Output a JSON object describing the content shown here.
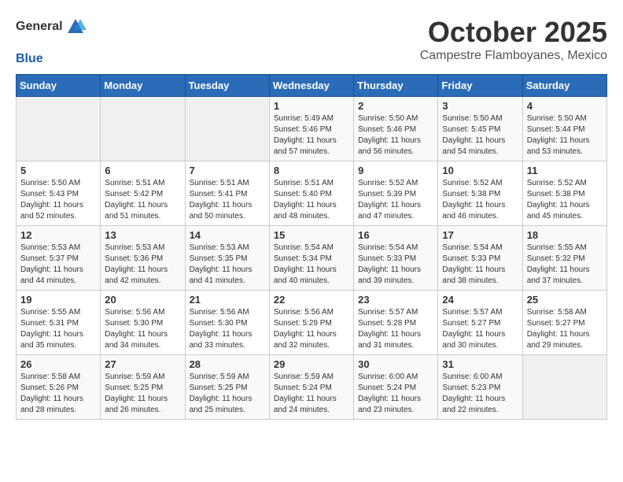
{
  "header": {
    "logo_general": "General",
    "logo_blue": "Blue",
    "month_title": "October 2025",
    "location": "Campestre Flamboyanes, Mexico"
  },
  "weekdays": [
    "Sunday",
    "Monday",
    "Tuesday",
    "Wednesday",
    "Thursday",
    "Friday",
    "Saturday"
  ],
  "weeks": [
    [
      {
        "day": "",
        "info": ""
      },
      {
        "day": "",
        "info": ""
      },
      {
        "day": "",
        "info": ""
      },
      {
        "day": "1",
        "info": "Sunrise: 5:49 AM\nSunset: 5:46 PM\nDaylight: 11 hours and 57 minutes."
      },
      {
        "day": "2",
        "info": "Sunrise: 5:50 AM\nSunset: 5:46 PM\nDaylight: 11 hours and 56 minutes."
      },
      {
        "day": "3",
        "info": "Sunrise: 5:50 AM\nSunset: 5:45 PM\nDaylight: 11 hours and 54 minutes."
      },
      {
        "day": "4",
        "info": "Sunrise: 5:50 AM\nSunset: 5:44 PM\nDaylight: 11 hours and 53 minutes."
      }
    ],
    [
      {
        "day": "5",
        "info": "Sunrise: 5:50 AM\nSunset: 5:43 PM\nDaylight: 11 hours and 52 minutes."
      },
      {
        "day": "6",
        "info": "Sunrise: 5:51 AM\nSunset: 5:42 PM\nDaylight: 11 hours and 51 minutes."
      },
      {
        "day": "7",
        "info": "Sunrise: 5:51 AM\nSunset: 5:41 PM\nDaylight: 11 hours and 50 minutes."
      },
      {
        "day": "8",
        "info": "Sunrise: 5:51 AM\nSunset: 5:40 PM\nDaylight: 11 hours and 48 minutes."
      },
      {
        "day": "9",
        "info": "Sunrise: 5:52 AM\nSunset: 5:39 PM\nDaylight: 11 hours and 47 minutes."
      },
      {
        "day": "10",
        "info": "Sunrise: 5:52 AM\nSunset: 5:38 PM\nDaylight: 11 hours and 46 minutes."
      },
      {
        "day": "11",
        "info": "Sunrise: 5:52 AM\nSunset: 5:38 PM\nDaylight: 11 hours and 45 minutes."
      }
    ],
    [
      {
        "day": "12",
        "info": "Sunrise: 5:53 AM\nSunset: 5:37 PM\nDaylight: 11 hours and 44 minutes."
      },
      {
        "day": "13",
        "info": "Sunrise: 5:53 AM\nSunset: 5:36 PM\nDaylight: 11 hours and 42 minutes."
      },
      {
        "day": "14",
        "info": "Sunrise: 5:53 AM\nSunset: 5:35 PM\nDaylight: 11 hours and 41 minutes."
      },
      {
        "day": "15",
        "info": "Sunrise: 5:54 AM\nSunset: 5:34 PM\nDaylight: 11 hours and 40 minutes."
      },
      {
        "day": "16",
        "info": "Sunrise: 5:54 AM\nSunset: 5:33 PM\nDaylight: 11 hours and 39 minutes."
      },
      {
        "day": "17",
        "info": "Sunrise: 5:54 AM\nSunset: 5:33 PM\nDaylight: 11 hours and 38 minutes."
      },
      {
        "day": "18",
        "info": "Sunrise: 5:55 AM\nSunset: 5:32 PM\nDaylight: 11 hours and 37 minutes."
      }
    ],
    [
      {
        "day": "19",
        "info": "Sunrise: 5:55 AM\nSunset: 5:31 PM\nDaylight: 11 hours and 35 minutes."
      },
      {
        "day": "20",
        "info": "Sunrise: 5:56 AM\nSunset: 5:30 PM\nDaylight: 11 hours and 34 minutes."
      },
      {
        "day": "21",
        "info": "Sunrise: 5:56 AM\nSunset: 5:30 PM\nDaylight: 11 hours and 33 minutes."
      },
      {
        "day": "22",
        "info": "Sunrise: 5:56 AM\nSunset: 5:29 PM\nDaylight: 11 hours and 32 minutes."
      },
      {
        "day": "23",
        "info": "Sunrise: 5:57 AM\nSunset: 5:28 PM\nDaylight: 11 hours and 31 minutes."
      },
      {
        "day": "24",
        "info": "Sunrise: 5:57 AM\nSunset: 5:27 PM\nDaylight: 11 hours and 30 minutes."
      },
      {
        "day": "25",
        "info": "Sunrise: 5:58 AM\nSunset: 5:27 PM\nDaylight: 11 hours and 29 minutes."
      }
    ],
    [
      {
        "day": "26",
        "info": "Sunrise: 5:58 AM\nSunset: 5:26 PM\nDaylight: 11 hours and 28 minutes."
      },
      {
        "day": "27",
        "info": "Sunrise: 5:59 AM\nSunset: 5:25 PM\nDaylight: 11 hours and 26 minutes."
      },
      {
        "day": "28",
        "info": "Sunrise: 5:59 AM\nSunset: 5:25 PM\nDaylight: 11 hours and 25 minutes."
      },
      {
        "day": "29",
        "info": "Sunrise: 5:59 AM\nSunset: 5:24 PM\nDaylight: 11 hours and 24 minutes."
      },
      {
        "day": "30",
        "info": "Sunrise: 6:00 AM\nSunset: 5:24 PM\nDaylight: 11 hours and 23 minutes."
      },
      {
        "day": "31",
        "info": "Sunrise: 6:00 AM\nSunset: 5:23 PM\nDaylight: 11 hours and 22 minutes."
      },
      {
        "day": "",
        "info": ""
      }
    ]
  ]
}
